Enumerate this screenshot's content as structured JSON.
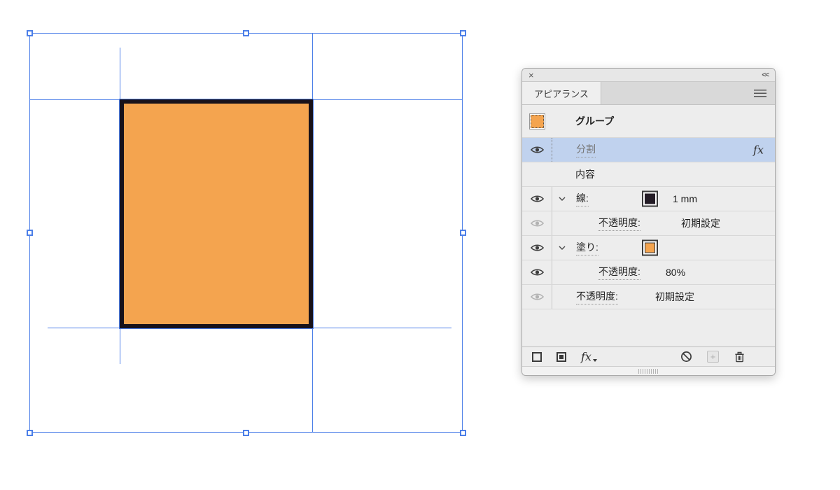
{
  "colors": {
    "selection-blue": "#4C7FE8",
    "artwork-fill": "#F4A44F",
    "artwork-stroke": "#18121A",
    "selected-row": "#C0D2EE",
    "panel-bg": "#EDEDED"
  },
  "window": {
    "close_label": "×",
    "collapse_label": "<<",
    "tab_label": "アピアランス"
  },
  "rows": [
    {
      "id": "group",
      "label": "グループ"
    },
    {
      "id": "divide",
      "label": "分割",
      "badge": "fx",
      "selected": true
    },
    {
      "id": "contents",
      "label": "内容"
    },
    {
      "id": "stroke",
      "label": "線:",
      "value": "1 mm"
    },
    {
      "id": "stroke-opacity",
      "label": "不透明度:",
      "value": "初期設定",
      "dimmed": true
    },
    {
      "id": "fill",
      "label": "塗り:"
    },
    {
      "id": "fill-opacity",
      "label": "不透明度:",
      "value": "80%"
    },
    {
      "id": "group-opacity",
      "label": "不透明度:",
      "value": "初期設定",
      "dimmed": true
    }
  ],
  "toolbar": {
    "fx_label": "fx"
  },
  "icons": {
    "close": "close-icon",
    "collapse": "collapse-panel-icon",
    "panel_menu": "panel-menu-icon",
    "visibility": "eye-icon",
    "expand": "chevron-down-icon",
    "new_stroke": "new-stroke-icon",
    "new_fill": "new-fill-icon",
    "add_effect": "fx-menu-icon",
    "clear_appearance": "clear-appearance-icon",
    "duplicate_item": "plus-icon",
    "delete_item": "trash-icon",
    "resize": "resize-grip-icon"
  }
}
